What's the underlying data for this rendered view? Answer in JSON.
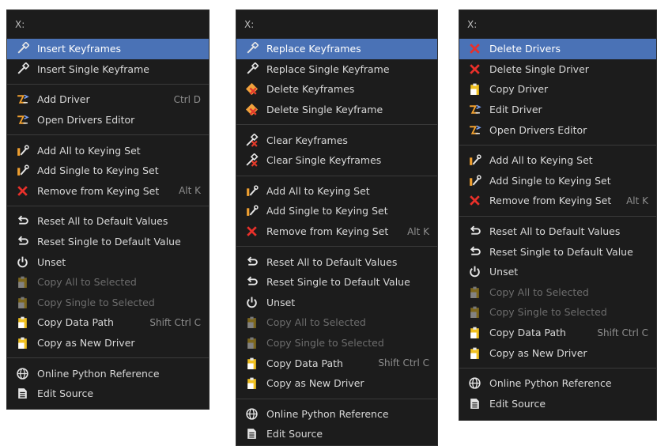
{
  "colors": {
    "menu_bg": "#1c1c1c",
    "highlight": "#4a72b6",
    "text": "#d8d8d8",
    "disabled": "#6d6d6d",
    "shortcut": "#8e8e8e"
  },
  "menus": [
    {
      "header": "X:",
      "groups": [
        [
          {
            "label": "Insert Keyframes",
            "icon": "keyframe-icon",
            "active": true
          },
          {
            "label": "Insert Single Keyframe",
            "icon": "keyframe-icon"
          }
        ],
        [
          {
            "label": "Add Driver",
            "icon": "driver-icon",
            "shortcut": "Ctrl D"
          },
          {
            "label": "Open Drivers Editor",
            "icon": "driver-icon"
          }
        ],
        [
          {
            "label": "Add All to Keying Set",
            "icon": "keying-set-icon"
          },
          {
            "label": "Add Single to Keying Set",
            "icon": "keying-set-icon"
          },
          {
            "label": "Remove from Keying Set",
            "icon": "x-icon",
            "shortcut": "Alt K"
          }
        ],
        [
          {
            "label": "Reset All to Default Values",
            "icon": "reset-icon"
          },
          {
            "label": "Reset Single to Default Value",
            "icon": "reset-icon"
          },
          {
            "label": "Unset",
            "icon": "power-icon"
          },
          {
            "label": "Copy All to Selected",
            "icon": "clipboard-icon",
            "disabled": true
          },
          {
            "label": "Copy Single to Selected",
            "icon": "clipboard-icon",
            "disabled": true
          },
          {
            "label": "Copy Data Path",
            "icon": "clipboard-icon",
            "shortcut": "Shift Ctrl C"
          },
          {
            "label": "Copy as New Driver",
            "icon": "clipboard-icon"
          }
        ],
        [
          {
            "label": "Online Python Reference",
            "icon": "globe-icon"
          },
          {
            "label": "Edit Source",
            "icon": "text-file-icon"
          }
        ]
      ]
    },
    {
      "header": "X:",
      "groups": [
        [
          {
            "label": "Replace Keyframes",
            "icon": "keyframe-icon",
            "active": true
          },
          {
            "label": "Replace Single Keyframe",
            "icon": "keyframe-icon"
          },
          {
            "label": "Delete Keyframes",
            "icon": "keyframe-delete-icon"
          },
          {
            "label": "Delete Single Keyframe",
            "icon": "keyframe-delete-icon"
          }
        ],
        [
          {
            "label": "Clear Keyframes",
            "icon": "keyframe-clear-icon"
          },
          {
            "label": "Clear Single Keyframes",
            "icon": "keyframe-clear-icon"
          }
        ],
        [
          {
            "label": "Add All to Keying Set",
            "icon": "keying-set-icon"
          },
          {
            "label": "Add Single to Keying Set",
            "icon": "keying-set-icon"
          },
          {
            "label": "Remove from Keying Set",
            "icon": "x-icon",
            "shortcut": "Alt K"
          }
        ],
        [
          {
            "label": "Reset All to Default Values",
            "icon": "reset-icon"
          },
          {
            "label": "Reset Single to Default Value",
            "icon": "reset-icon"
          },
          {
            "label": "Unset",
            "icon": "power-icon"
          },
          {
            "label": "Copy All to Selected",
            "icon": "clipboard-icon",
            "disabled": true
          },
          {
            "label": "Copy Single to Selected",
            "icon": "clipboard-icon",
            "disabled": true
          },
          {
            "label": "Copy Data Path",
            "icon": "clipboard-icon",
            "shortcut": "Shift Ctrl C"
          },
          {
            "label": "Copy as New Driver",
            "icon": "clipboard-icon"
          }
        ],
        [
          {
            "label": "Online Python Reference",
            "icon": "globe-icon"
          },
          {
            "label": "Edit Source",
            "icon": "text-file-icon"
          }
        ]
      ]
    },
    {
      "header": "X:",
      "groups": [
        [
          {
            "label": "Delete Drivers",
            "icon": "x-icon",
            "active": true
          },
          {
            "label": "Delete Single Driver",
            "icon": "x-icon"
          },
          {
            "label": "Copy Driver",
            "icon": "clipboard-icon"
          },
          {
            "label": "Edit Driver",
            "icon": "driver-icon"
          },
          {
            "label": "Open Drivers Editor",
            "icon": "driver-icon"
          }
        ],
        [
          {
            "label": "Add All to Keying Set",
            "icon": "keying-set-icon"
          },
          {
            "label": "Add Single to Keying Set",
            "icon": "keying-set-icon"
          },
          {
            "label": "Remove from Keying Set",
            "icon": "x-icon",
            "shortcut": "Alt K"
          }
        ],
        [
          {
            "label": "Reset All to Default Values",
            "icon": "reset-icon"
          },
          {
            "label": "Reset Single to Default Value",
            "icon": "reset-icon"
          },
          {
            "label": "Unset",
            "icon": "power-icon"
          },
          {
            "label": "Copy All to Selected",
            "icon": "clipboard-icon",
            "disabled": true
          },
          {
            "label": "Copy Single to Selected",
            "icon": "clipboard-icon",
            "disabled": true
          },
          {
            "label": "Copy Data Path",
            "icon": "clipboard-icon",
            "shortcut": "Shift Ctrl C"
          },
          {
            "label": "Copy as New Driver",
            "icon": "clipboard-icon"
          }
        ],
        [
          {
            "label": "Online Python Reference",
            "icon": "globe-icon"
          },
          {
            "label": "Edit Source",
            "icon": "text-file-icon"
          }
        ]
      ]
    }
  ]
}
